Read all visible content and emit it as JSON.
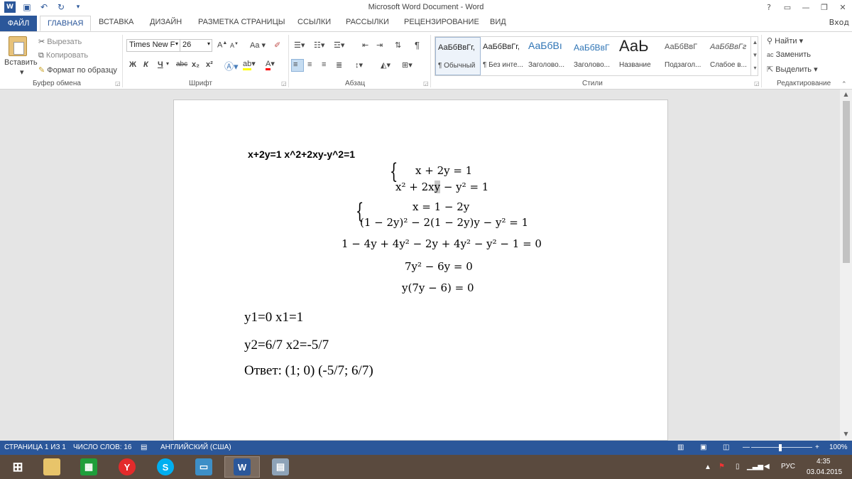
{
  "window": {
    "title": "Microsoft Word Document - Word",
    "help": "?",
    "login": "Вход"
  },
  "tabs": [
    "ФАЙЛ",
    "ГЛАВНАЯ",
    "ВСТАВКА",
    "ДИЗАЙН",
    "РАЗМЕТКА СТРАНИЦЫ",
    "ССЫЛКИ",
    "РАССЫЛКИ",
    "РЕЦЕНЗИРОВАНИЕ",
    "ВИД"
  ],
  "clipboard": {
    "paste": "Вставить",
    "cut": "Вырезать",
    "copy": "Копировать",
    "format_painter": "Формат по образцу",
    "label": "Буфер обмена"
  },
  "font": {
    "name": "Times New F",
    "size": "26",
    "bold": "Ж",
    "italic": "К",
    "underline": "Ч",
    "strike": "abc",
    "subscript": "x₂",
    "superscript": "x²",
    "case": "Aa",
    "grow": "A",
    "shrink": "A",
    "label": "Шрифт"
  },
  "paragraph": {
    "label": "Абзац"
  },
  "styles": {
    "items": [
      {
        "sample": "АаБбВвГг,",
        "name": "¶ Обычный"
      },
      {
        "sample": "АаБбВвГг,",
        "name": "¶ Без инте..."
      },
      {
        "sample": "АаБбВı",
        "name": "Заголово..."
      },
      {
        "sample": "АаБбВвГ",
        "name": "Заголово..."
      },
      {
        "sample": "АаЬ",
        "name": "Название"
      },
      {
        "sample": "АаБбВвГ",
        "name": "Подзагол..."
      },
      {
        "sample": "АаБбВвГг",
        "name": "Слабое в..."
      }
    ],
    "label": "Стили"
  },
  "editing": {
    "find": "Найти",
    "replace": "Заменить",
    "select": "Выделить",
    "label": "Редактирование"
  },
  "document": {
    "line1": "x+2y=1 x^2+2xy-y^2=1",
    "sys1_eq1": "x + 2y = 1",
    "sys1_eq2_pre": "x² + 2x",
    "sys1_eq2_hl": "y",
    "sys1_eq2_post": " − y² = 1",
    "sys2_eq1": "x = 1 − 2y",
    "sys2_eq2": "(1 − 2y)² − 2(1 − 2y)y − y² = 1",
    "eq3": "1 − 4y + 4y² − 2y + 4y² − y² − 1 = 0",
    "eq4": "7y² − 6y = 0",
    "eq5": "y(7y − 6) = 0",
    "ans1": "y1=0 x1=1",
    "ans2": "y2=6/7 x2=-5/7",
    "ans3": "Ответ: (1; 0) (-5/7; 6/7)"
  },
  "status": {
    "page": "СТРАНИЦА 1 ИЗ 1",
    "words": "ЧИСЛО СЛОВ: 16",
    "lang": "АНГЛИЙСКИЙ (США)",
    "zoom": "100%"
  },
  "taskbar": {
    "lang": "РУС",
    "time": "4:35",
    "date": "03.04.2015"
  }
}
